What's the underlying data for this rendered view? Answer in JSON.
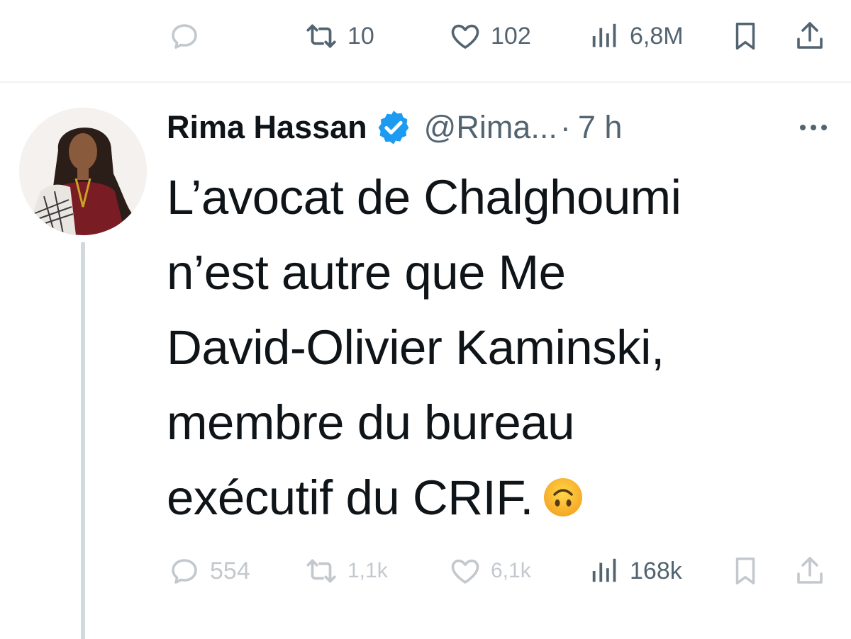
{
  "top_actions": {
    "retweets": "10",
    "likes": "102",
    "views": "6,8M"
  },
  "tweet": {
    "author_name": "Rima Hassan",
    "handle": "@Rima...",
    "separator": "·",
    "time": "7 h",
    "text_lines": [
      "L’avocat de Chalghoumi",
      "n’est autre que Me",
      "David-Olivier Kaminski,",
      "membre du bureau",
      "exécutif du CRIF."
    ],
    "emoji": "upside-down-face"
  },
  "bottom_actions": {
    "replies": "554",
    "retweets": "1,1k",
    "likes": "6,1k",
    "views": "168k"
  },
  "colors": {
    "text": "#0f1419",
    "secondary": "#536471",
    "verified": "#1d9bf0",
    "divider": "#eff3f4",
    "thread_line": "#cfd9de"
  },
  "icons": {
    "reply": "reply-icon",
    "retweet": "retweet-icon",
    "like": "heart-icon",
    "views": "views-icon",
    "bookmark": "bookmark-icon",
    "share": "share-icon",
    "verified": "verified-badge-icon",
    "more": "more-icon"
  }
}
